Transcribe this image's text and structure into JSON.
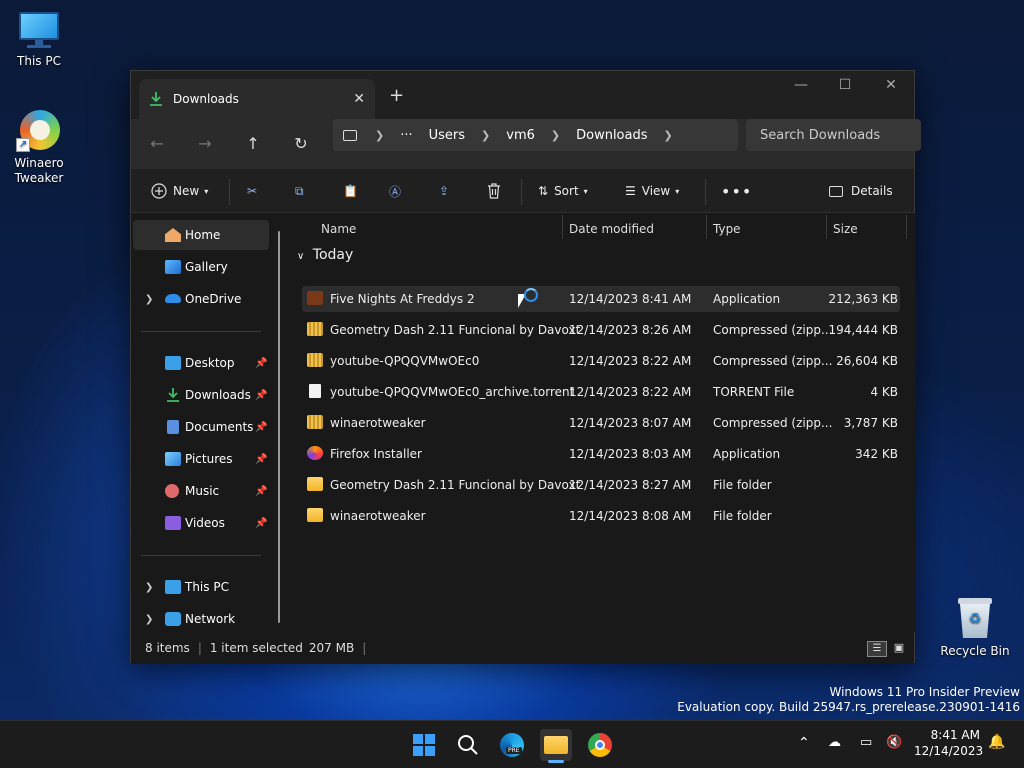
{
  "desktop": {
    "icons": [
      {
        "label": "This PC"
      },
      {
        "label": "Winaero Tweaker"
      },
      {
        "label": "Recycle Bin"
      }
    ],
    "watermark": {
      "line1": "Windows 11 Pro Insider Preview",
      "line2": "Evaluation copy. Build 25947.rs_prerelease.230901-1416"
    }
  },
  "explorer": {
    "tab": {
      "title": "Downloads"
    },
    "address": {
      "crumbs": [
        "Users",
        "vm6",
        "Downloads"
      ],
      "more": "···"
    },
    "search": {
      "placeholder": "Search Downloads"
    },
    "toolbar": {
      "new": "New",
      "sort": "Sort",
      "view": "View",
      "details": "Details"
    },
    "sidebar": {
      "home": "Home",
      "gallery": "Gallery",
      "onedrive": "OneDrive",
      "quick": [
        {
          "label": "Desktop",
          "color": "#3aa0e8"
        },
        {
          "label": "Downloads",
          "color": "#3fbf6a"
        },
        {
          "label": "Documents",
          "color": "#5b8fe0"
        },
        {
          "label": "Pictures",
          "color": "#4a9ee8"
        },
        {
          "label": "Music",
          "color": "#e06a6a"
        },
        {
          "label": "Videos",
          "color": "#8a5ee0"
        }
      ],
      "thispc": "This PC",
      "network": "Network"
    },
    "columns": {
      "name": "Name",
      "date": "Date modified",
      "type": "Type",
      "size": "Size"
    },
    "group": "Today",
    "files": [
      {
        "name": "Five Nights At Freddys 2",
        "date": "12/14/2023 8:41 AM",
        "type": "Application",
        "size": "212,363 KB",
        "icon": "app-icon",
        "selected": true
      },
      {
        "name": "Geometry Dash 2.11 Funcional by Davoxt",
        "date": "12/14/2023 8:26 AM",
        "type": "Compressed (zipp...",
        "size": "194,444 KB",
        "icon": "zip-folder-icon"
      },
      {
        "name": "youtube-QPQQVMwOEc0",
        "date": "12/14/2023 8:22 AM",
        "type": "Compressed (zipp...",
        "size": "26,604 KB",
        "icon": "zip-folder-icon"
      },
      {
        "name": "youtube-QPQQVMwOEc0_archive.torrent",
        "date": "12/14/2023 8:22 AM",
        "type": "TORRENT File",
        "size": "4 KB",
        "icon": "file-icon"
      },
      {
        "name": "winaerotweaker",
        "date": "12/14/2023 8:07 AM",
        "type": "Compressed (zipp...",
        "size": "3,787 KB",
        "icon": "zip-folder-icon"
      },
      {
        "name": "Firefox Installer",
        "date": "12/14/2023 8:03 AM",
        "type": "Application",
        "size": "342 KB",
        "icon": "firefox-icon"
      },
      {
        "name": "Geometry Dash 2.11 Funcional by Davoxt",
        "date": "12/14/2023 8:27 AM",
        "type": "File folder",
        "size": "",
        "icon": "folder-icon"
      },
      {
        "name": "winaerotweaker",
        "date": "12/14/2023 8:08 AM",
        "type": "File folder",
        "size": "",
        "icon": "folder-icon"
      }
    ],
    "status": {
      "count": "8 items",
      "selection": "1 item selected",
      "size": "207 MB"
    }
  },
  "taskbar": {
    "time": "8:41 AM",
    "date": "12/14/2023",
    "edge_badge": "PRE"
  }
}
